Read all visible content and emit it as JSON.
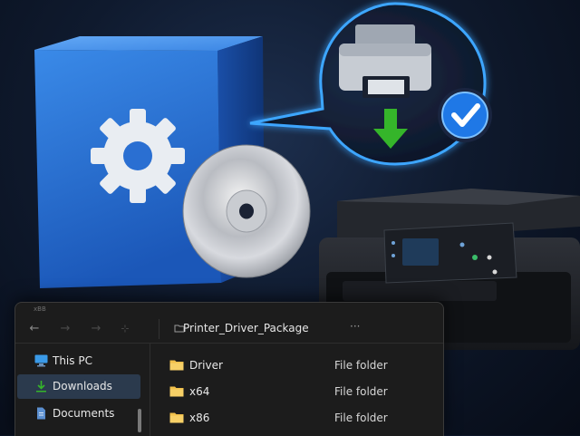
{
  "explorer": {
    "window_title": "xBB",
    "address_path": "Printer_Driver_Package",
    "address_more": "···",
    "nav": [
      {
        "label": "This PC",
        "icon": "computer-icon"
      },
      {
        "label": "Downloads",
        "icon": "download-icon"
      },
      {
        "label": "Documents",
        "icon": "document-icon"
      }
    ],
    "files": [
      {
        "name": "Driver",
        "type": "File folder",
        "icon": "folder-icon"
      },
      {
        "name": "x64",
        "type": "File folder",
        "icon": "folder-icon"
      },
      {
        "name": "x86",
        "type": "File folder",
        "icon": "folder-icon"
      }
    ],
    "selected_nav": "Downloads"
  },
  "colors": {
    "accent_blue": "#2b7fe0",
    "checkmark_badge": "#1f78e6",
    "download_arrow": "#35b52a",
    "folder": "#f2c14b"
  },
  "icons": [
    "gear-icon",
    "printer-icon",
    "checkmark-icon",
    "download-arrow-icon",
    "cd-disc-icon"
  ]
}
